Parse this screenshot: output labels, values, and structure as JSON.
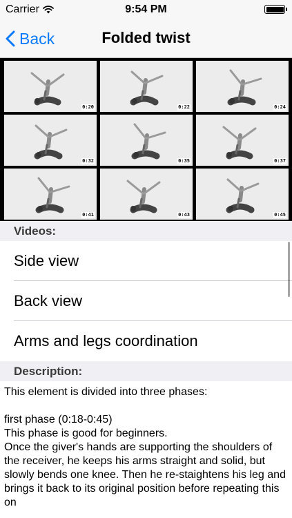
{
  "status_bar": {
    "carrier": "Carrier",
    "time": "9:54 PM",
    "wifi_icon": "wifi-icon",
    "battery_icon": "battery-icon",
    "battery_level": 1.0
  },
  "nav": {
    "back_label": "Back",
    "back_icon": "chevron-left-icon",
    "title": "Folded twist"
  },
  "gallery": {
    "thumbnails": [
      {
        "timestamp": "0:20"
      },
      {
        "timestamp": "0:22"
      },
      {
        "timestamp": "0:24"
      },
      {
        "timestamp": "0:32"
      },
      {
        "timestamp": "0:35"
      },
      {
        "timestamp": "0:37"
      },
      {
        "timestamp": "0:41"
      },
      {
        "timestamp": "0:43"
      },
      {
        "timestamp": "0:45"
      }
    ]
  },
  "videos": {
    "header": "Videos:",
    "items": [
      {
        "label": "Side view"
      },
      {
        "label": "Back view"
      },
      {
        "label": "Arms and legs coordination"
      }
    ]
  },
  "description": {
    "header": "Description:",
    "text": "This element is divided into three phases:\n\nfirst phase (0:18-0:45)\nThis phase is good for beginners.\nOnce the giver's hands are supporting the shoulders of the receiver, he keeps his arms straight and solid, but slowly bends one knee. Then he re-staightens his leg and brings it back to its original position before repeating this on"
  },
  "colors": {
    "accent": "#0a7aff",
    "bar_background": "#f7f7f7",
    "section_background": "#efeff4",
    "gallery_background": "#000000"
  }
}
